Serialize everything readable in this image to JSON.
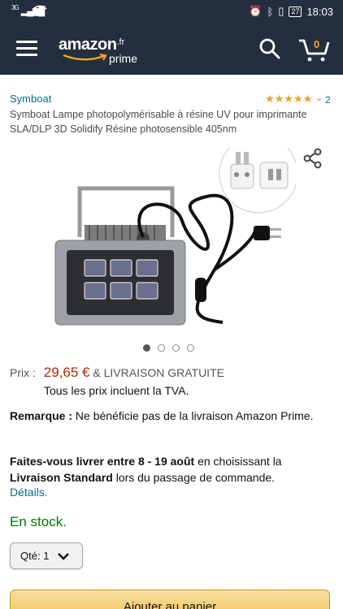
{
  "status_bar": {
    "network": "3G",
    "battery": "27",
    "time": "18:03"
  },
  "header": {
    "logo_word": "amazon",
    "logo_tld": ".fr",
    "logo_sub": "prime",
    "cart_count": "0"
  },
  "product": {
    "brand": "Symboat",
    "rating_stars": 4.5,
    "rating_count": "2",
    "title": "Symboat Lampe photopolymérisable à résine UV pour imprimante SLA/DLP 3D Solidify Résine photosensible 405nm",
    "image_count": 4,
    "image_active_index": 0
  },
  "pricing": {
    "label": "Prix :",
    "price": "29,65 €",
    "shipping": "& LIVRAISON GRATUITE",
    "vat_note": "Tous les prix incluent la TVA."
  },
  "remark": {
    "label": "Remarque :",
    "text": " Ne bénéficie pas de la livraison Amazon Prime."
  },
  "delivery": {
    "lead": "Faites-vous livrer entre 8 -  19 août",
    "middle": " en choisissant la ",
    "option": "Livraison Standard",
    "tail": " lors du passage de commande.",
    "details_link": "Détails."
  },
  "stock": "En stock.",
  "quantity": {
    "label": "Qté:",
    "value": "1"
  },
  "add_to_cart": "Ajouter au panier",
  "colors": {
    "header_bg": "#232f3e",
    "link": "#007185",
    "price": "#b12704",
    "in_stock": "#007600",
    "star": "#e8a224",
    "cart_button": "#f0c14b"
  }
}
